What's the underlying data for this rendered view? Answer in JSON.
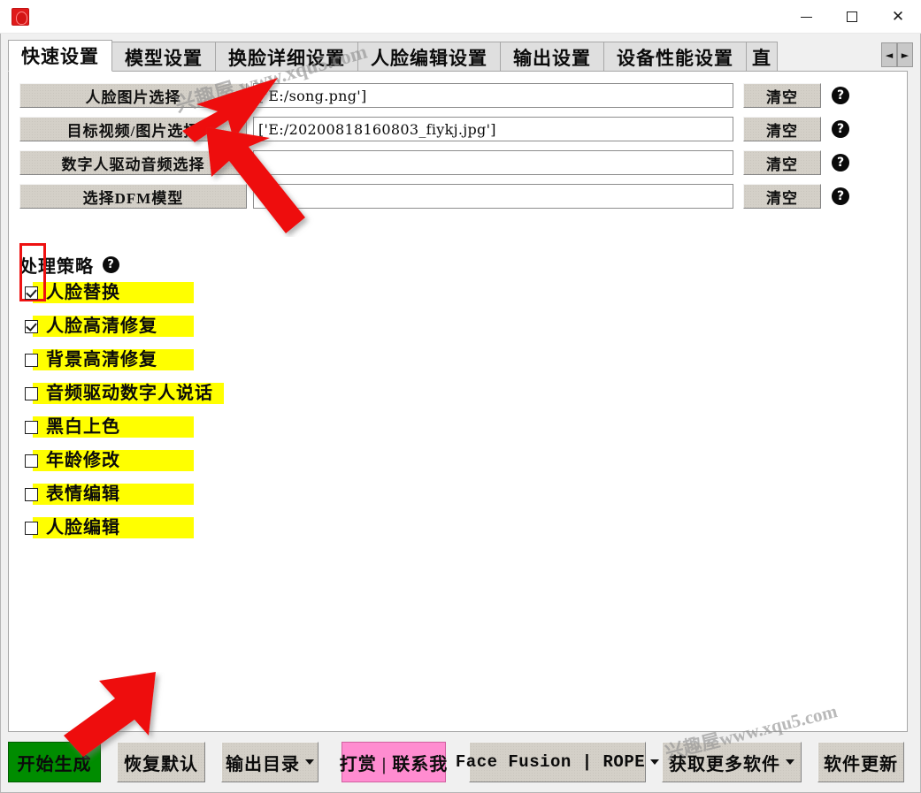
{
  "window": {
    "app_icon": "app-logo-icon",
    "minimize_label": "─",
    "maximize_label": "☐",
    "close_label": "✕"
  },
  "tabs": {
    "items": [
      {
        "label": "快速设置",
        "active": true
      },
      {
        "label": "模型设置",
        "active": false
      },
      {
        "label": "换脸详细设置",
        "active": false
      },
      {
        "label": "人脸编辑设置",
        "active": false
      },
      {
        "label": "输出设置",
        "active": false
      },
      {
        "label": "设备性能设置",
        "active": false
      },
      {
        "label": "直",
        "active": false
      }
    ],
    "scroll_left": "◄",
    "scroll_right": "►"
  },
  "file_rows": [
    {
      "button_label": "人脸图片选择",
      "value": "['E:/song.png']",
      "clear_label": "清空",
      "help_label": "?"
    },
    {
      "button_label": "目标视频/图片选择",
      "value": "['E:/20200818160803_fiykj.jpg']",
      "clear_label": "清空",
      "help_label": "?"
    },
    {
      "button_label": "数字人驱动音频选择",
      "value": "",
      "clear_label": "清空",
      "help_label": "?"
    },
    {
      "button_label": "选择DFM模型",
      "value": "",
      "clear_label": "清空",
      "help_label": "?"
    }
  ],
  "strategy": {
    "title": "处理策略",
    "help_label": "?",
    "options": [
      {
        "label": "人脸替换",
        "checked": true,
        "strip_width": 182
      },
      {
        "label": "人脸高清修复",
        "checked": true,
        "strip_width": 182
      },
      {
        "label": "背景高清修复",
        "checked": false,
        "strip_width": 182
      },
      {
        "label": "音频驱动数字人说话",
        "checked": false,
        "strip_width": 216
      },
      {
        "label": "黑白上色",
        "checked": false,
        "strip_width": 182
      },
      {
        "label": "年龄修改",
        "checked": false,
        "strip_width": 182
      },
      {
        "label": "表情编辑",
        "checked": false,
        "strip_width": 182
      },
      {
        "label": "人脸编辑",
        "checked": false,
        "strip_width": 182
      }
    ]
  },
  "toolbar": {
    "start_label": "开始生成",
    "restore_label": "恢复默认",
    "output_dir_label": "输出目录",
    "donate_label": "打赏 | 联系我",
    "facefusion_label": "Face Fusion | ROPE",
    "more_software_label": "获取更多软件",
    "update_label": "软件更新"
  },
  "watermarks": {
    "top": "兴趣屋 www.xqu5.com",
    "bottom": "兴趣屋www.xqu5.com"
  },
  "colors": {
    "accent_yellow": "#ffff00",
    "start_green": "#008c00",
    "donate_pink": "#ff8cd0",
    "annotation_red": "#ee1111",
    "button_face": "#d4d0c8"
  }
}
